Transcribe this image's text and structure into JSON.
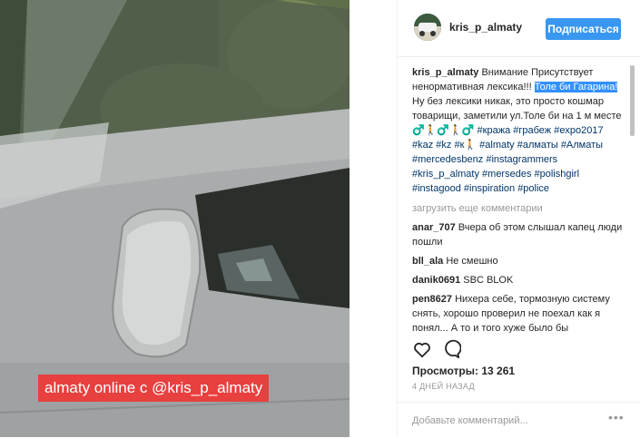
{
  "media": {
    "caption": "almaty online c @kris_p_almaty"
  },
  "header": {
    "username": "kris_p_almaty",
    "follow_label": "Подписаться"
  },
  "caption": {
    "username": "kris_p_almaty",
    "text_before": "Внимание Присутствует ненормативная лексика!!!",
    "selected_text": "Толе би Гагарина!",
    "text_after": "Ну без лексики никак, это просто кошмар товарищи, заметили ул.Толе би на 1 м месте ♂️🚶♂️🚶♂️",
    "hashtags": "#кража #грабеж #expo2017 #kaz #kz #к🚶 #almaty #алматы #Алматы #mercedesbenz #instagrammers #kris_p_almaty #mersedes #polishgirl #instagood #inspiration #police"
  },
  "load_more": "загрузить еще комментарии",
  "comments": [
    {
      "user": "anar_707",
      "text": "Вчера об этом слышал капец люди пошли"
    },
    {
      "user": "bll_ala",
      "text": "Не смешно"
    },
    {
      "user": "danik0691",
      "text": "SBC BLOK"
    },
    {
      "user": "pen8627",
      "text": "Нихера себе, тормозную систему снять, хорошо проверил не поехал как я понял... А то и того хуже было бы"
    }
  ],
  "stats": {
    "views_label": "Просмотры:",
    "views_count": "13 261",
    "time": "4 ДНЕЙ НАЗАД"
  },
  "add_comment": {
    "placeholder": "Добавьте комментарий...",
    "more_label": "•••"
  },
  "icons": {
    "like": "heart-icon",
    "comment": "comment-bubble-icon"
  }
}
